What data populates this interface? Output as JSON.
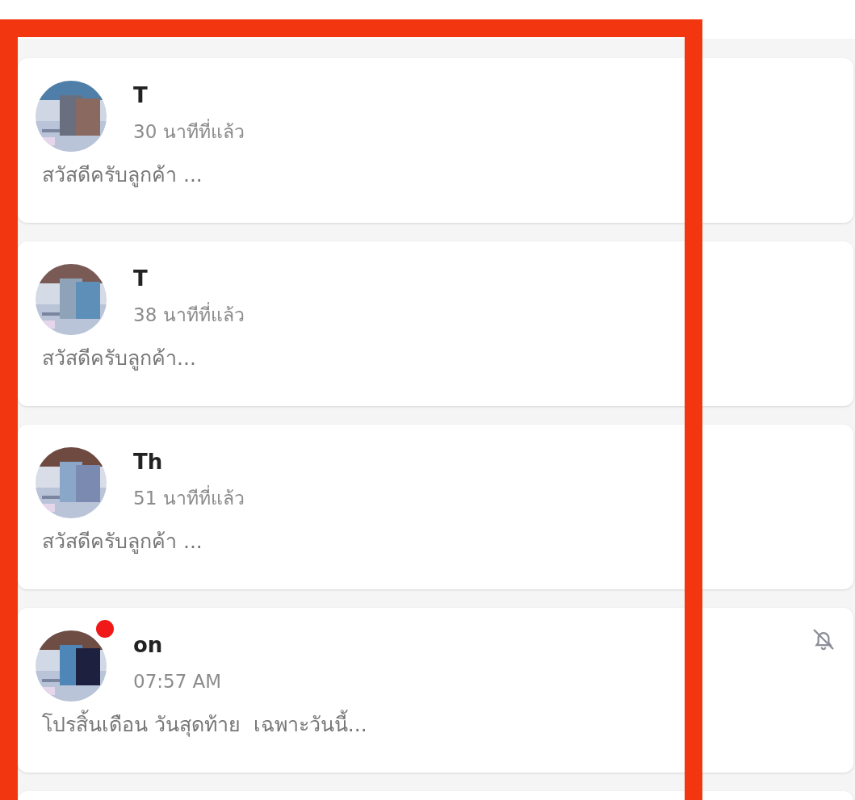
{
  "chats": [
    {
      "name": "T",
      "time": "30 นาทีที่แล้ว",
      "message": "สวัสดีครับลูกค้า ...",
      "unread": false,
      "muted": false
    },
    {
      "name": "T",
      "time": "38 นาทีที่แล้ว",
      "message": "สวัสดีครับลูกค้า...",
      "unread": false,
      "muted": false
    },
    {
      "name": "Th",
      "time": "51 นาทีที่แล้ว",
      "message": "สวัสดีครับลูกค้า ...",
      "unread": false,
      "muted": false
    },
    {
      "name": "on",
      "time": "07:57 AM",
      "message": "โปรสิ้นเดือน วันสุดท้าย  เฉพาะวันนี้...",
      "unread": true,
      "muted": true
    }
  ]
}
